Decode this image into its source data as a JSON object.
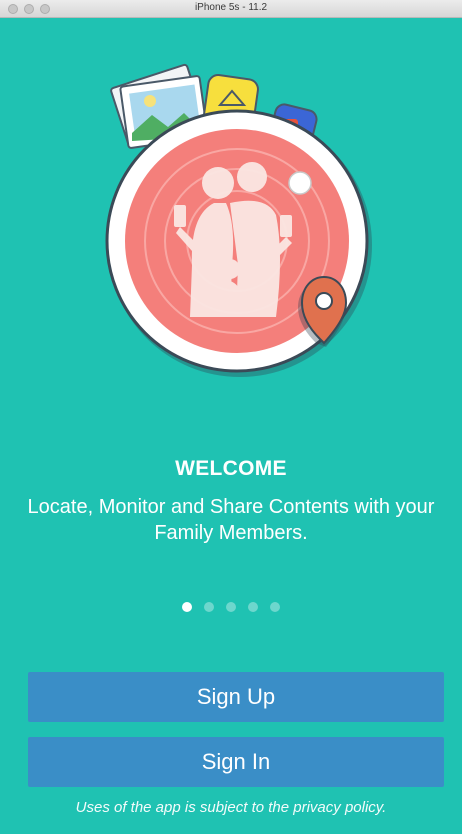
{
  "window": {
    "title": "iPhone 5s - 11.2"
  },
  "welcome": {
    "heading": "WELCOME",
    "subtitle": "Locate, Monitor and Share Contents with your Family Members."
  },
  "pager": {
    "count": 5,
    "active_index": 0
  },
  "actions": {
    "signup_label": "Sign Up",
    "signin_label": "Sign In"
  },
  "footer": {
    "text": "Uses of the app is subject to the privacy policy."
  },
  "colors": {
    "background": "#1fc2b2",
    "button": "#3a8ec7",
    "radar": "#f47f7b",
    "pin": "#e0714e"
  }
}
